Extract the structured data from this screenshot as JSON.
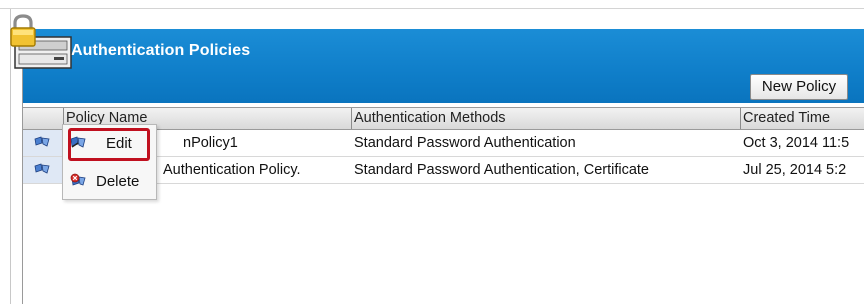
{
  "header": {
    "title": "Authentication Policies"
  },
  "toolbar": {
    "new_policy_label": "New Policy"
  },
  "table": {
    "columns": [
      "Policy Name",
      "Authentication Methods",
      "Created Time"
    ],
    "rows": [
      {
        "name": "nPolicy1",
        "methods": "Standard Password Authentication",
        "created": "Oct 3, 2014 11:5"
      },
      {
        "name": "Authentication Policy.",
        "methods": "Standard Password Authentication, Certificate",
        "created": "Jul 25, 2014 5:2"
      }
    ]
  },
  "context_menu": {
    "edit_label": "Edit",
    "delete_label": "Delete"
  },
  "colors": {
    "header_blue": "#0f7ec9",
    "highlight_red": "#c0101f"
  }
}
